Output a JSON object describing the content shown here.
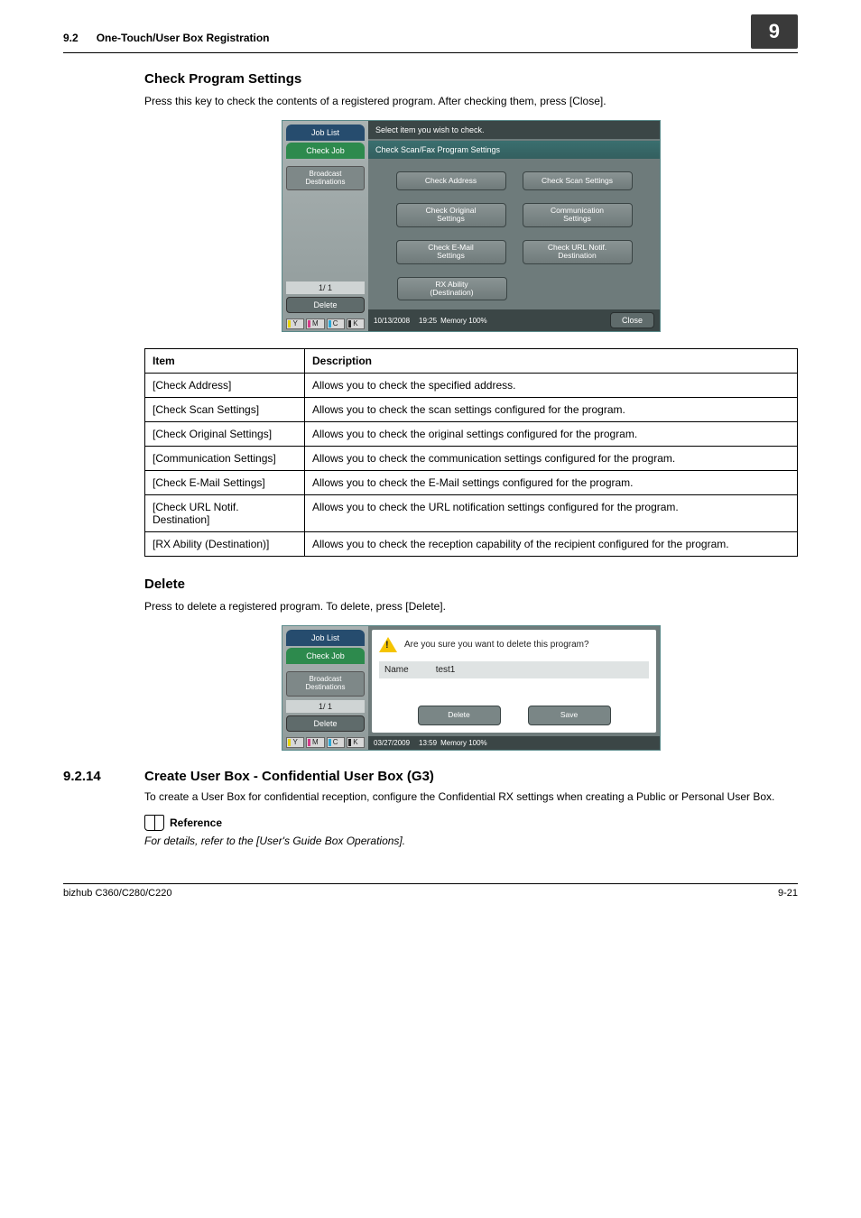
{
  "header": {
    "section_num": "9.2",
    "section_title": "One-Touch/User Box Registration",
    "chapter_num": "9"
  },
  "check_program": {
    "heading": "Check Program Settings",
    "intro": "Press this key to check the contents of a registered program. After checking them, press [Close].",
    "panel": {
      "side": {
        "job_list": "Job List",
        "check_job": "Check Job",
        "broadcast": "Broadcast\nDestinations",
        "page": "1/  1",
        "delete": "Delete"
      },
      "top_msg": "Select item you wish to check.",
      "titlebar": "Check Scan/Fax Program Settings",
      "buttons": {
        "check_address": "Check Address",
        "check_scan_settings": "Check Scan Settings",
        "check_original": "Check Original\nSettings",
        "communication": "Communication\nSettings",
        "check_email": "Check E-Mail\nSettings",
        "check_url": "Check URL Notif.\nDestination",
        "rx_ability": "RX Ability\n(Destination)"
      },
      "footer": {
        "date": "10/13/2008",
        "time": "19:25",
        "memory_label": "Memory",
        "memory_pct": "100%",
        "close": "Close"
      }
    },
    "table": {
      "h_item": "Item",
      "h_desc": "Description",
      "rows": [
        {
          "item": "[Check Address]",
          "desc": "Allows you to check the specified address."
        },
        {
          "item": "[Check Scan Settings]",
          "desc": "Allows you to check the scan settings configured for the program."
        },
        {
          "item": "[Check Original Settings]",
          "desc": "Allows you to check the original settings configured for the program."
        },
        {
          "item": "[Communication Settings]",
          "desc": "Allows you to check the communication settings configured for the program."
        },
        {
          "item": "[Check E-Mail Settings]",
          "desc": "Allows you to check the E-Mail settings configured for the program."
        },
        {
          "item": "[Check URL Notif. Destination]",
          "desc": "Allows you to check the URL notification settings configured for the program."
        },
        {
          "item": "[RX Ability (Destination)]",
          "desc": "Allows you to check the reception capability of the recipient configured for the program."
        }
      ]
    }
  },
  "delete_section": {
    "heading": "Delete",
    "intro": "Press to delete a registered program. To delete, press [Delete].",
    "panel": {
      "side": {
        "job_list": "Job List",
        "check_job": "Check Job",
        "broadcast": "Broadcast\nDestinations",
        "page": "1/  1",
        "delete": "Delete"
      },
      "warn_msg": "Are you sure you want to delete this program?",
      "name_label": "Name",
      "name_value": "test1",
      "buttons": {
        "delete": "Delete",
        "save": "Save"
      },
      "footer": {
        "date": "03/27/2009",
        "time": "13:59",
        "memory_label": "Memory",
        "memory_pct": "100%"
      }
    }
  },
  "subsection": {
    "num": "9.2.14",
    "title": "Create User Box - Confidential User Box (G3)",
    "body": "To create a User Box for confidential reception, configure the Confidential RX settings when creating a Public or Personal User Box.",
    "ref_label": "Reference",
    "ref_body": "For details, refer to the [User's Guide Box Operations]."
  },
  "footer": {
    "model": "bizhub C360/C280/C220",
    "page": "9-21"
  },
  "toner": {
    "y": "Y",
    "m": "M",
    "c": "C",
    "k": "K"
  }
}
